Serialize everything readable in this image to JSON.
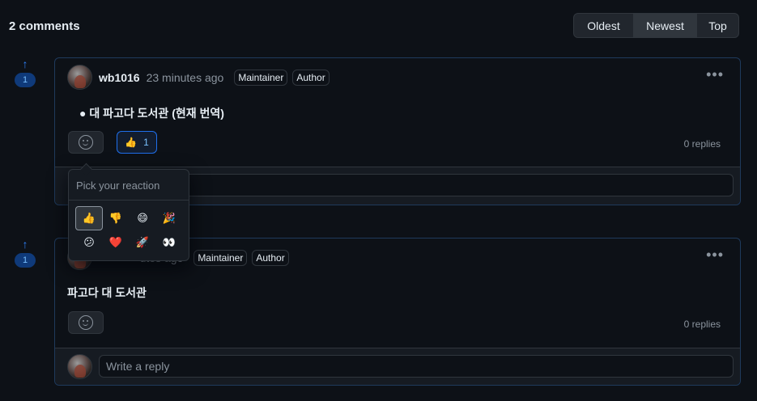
{
  "header": {
    "comment_count": "2 comments",
    "sort_options": [
      "Oldest",
      "Newest",
      "Top"
    ],
    "sort_selected": "Newest"
  },
  "comments": [
    {
      "vote_count": "1",
      "author": "wb1016",
      "time": "23 minutes ago",
      "badges": [
        "Maintainer",
        "Author"
      ],
      "body": "대 파고다 도서관 (현재 번역)",
      "reactions": [
        {
          "emoji": "👍",
          "count": "1"
        }
      ],
      "replies": "0 replies",
      "reply_placeholder": "Write a reply"
    },
    {
      "vote_count": "1",
      "author": "wb1016",
      "time": "utes ago",
      "badges": [
        "Maintainer",
        "Author"
      ],
      "body": "파고다 대 도서관",
      "replies": "0 replies",
      "reply_placeholder": "Write a reply"
    }
  ],
  "reaction_picker": {
    "title": "Pick your reaction",
    "emojis": [
      {
        "glyph": "👍",
        "name": "thumbs-up"
      },
      {
        "glyph": "👎",
        "name": "thumbs-down"
      },
      {
        "glyph": "😄",
        "name": "laugh"
      },
      {
        "glyph": "🎉",
        "name": "hooray"
      },
      {
        "glyph": "😕",
        "name": "confused"
      },
      {
        "glyph": "❤️",
        "name": "heart"
      },
      {
        "glyph": "🚀",
        "name": "rocket"
      },
      {
        "glyph": "👀",
        "name": "eyes"
      }
    ]
  },
  "colors": {
    "background": "#0d1117",
    "accent": "#2f81f7",
    "border_highlight": "#1f3a5c"
  }
}
